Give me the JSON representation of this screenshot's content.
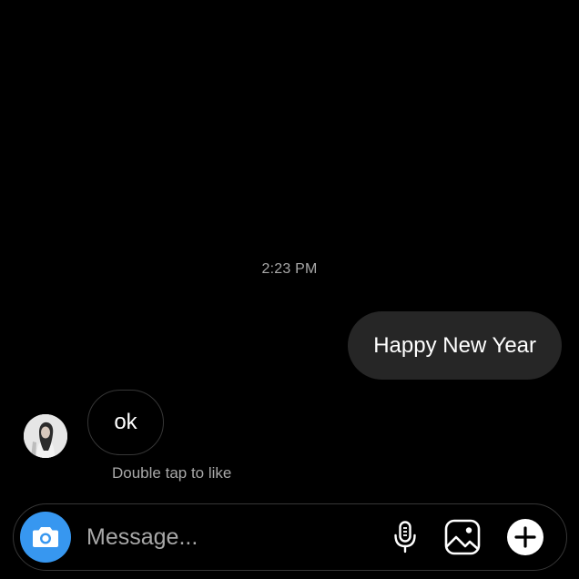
{
  "conversation": {
    "timestamp": "2:23 PM",
    "messages": [
      {
        "direction": "outgoing",
        "text": "Happy New Year"
      },
      {
        "direction": "incoming",
        "text": "ok",
        "hint": "Double tap to like"
      }
    ]
  },
  "composer": {
    "placeholder": "Message...",
    "value": ""
  },
  "icons": {
    "camera": "camera-icon",
    "mic": "microphone-icon",
    "gallery": "gallery-icon",
    "plus": "plus-icon"
  },
  "colors": {
    "background": "#000000",
    "outgoing_bubble": "#262626",
    "incoming_bubble_border": "#363636",
    "secondary_text": "#a8a8a8",
    "accent": "#3797f0"
  }
}
